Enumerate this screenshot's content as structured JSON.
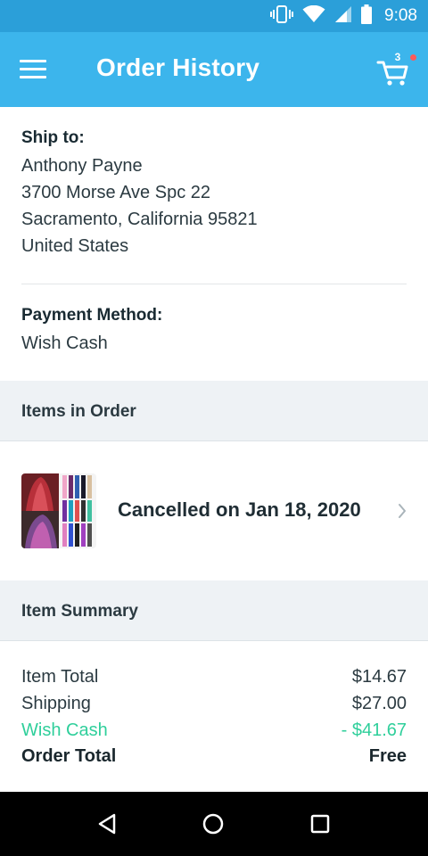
{
  "status_bar": {
    "time": "9:08"
  },
  "app_bar": {
    "title": "Order History",
    "cart_count": "3"
  },
  "shipping": {
    "label": "Ship to:",
    "name": "Anthony Payne",
    "street": "3700 Morse Ave Spc 22",
    "city_state_zip": "Sacramento, California 95821",
    "country": "United States"
  },
  "payment": {
    "label": "Payment Method:",
    "method": "Wish Cash"
  },
  "items_section": {
    "header": "Items in Order",
    "items": [
      {
        "status": "Cancelled on Jan 18, 2020"
      }
    ]
  },
  "summary": {
    "header": "Item Summary",
    "rows": [
      {
        "label": "Item Total",
        "value": "$14.67"
      },
      {
        "label": "Shipping",
        "value": "$27.00"
      },
      {
        "label": "Wish Cash",
        "value": "- $41.67"
      },
      {
        "label": "Order Total",
        "value": "Free"
      }
    ]
  },
  "colors": {
    "status_bar": "#2b9fd9",
    "app_bar": "#3cb5ec",
    "wish_cash_green": "#2fcf9b",
    "section_header_bg": "#eef2f5",
    "cart_badge_dot": "#ff5a5a"
  },
  "icons": {
    "menu": "hamburger-menu-icon",
    "cart": "shopping-cart-icon",
    "chevron": "chevron-right-icon",
    "nav_back": "triangle-back-icon",
    "nav_home": "circle-home-icon",
    "nav_recents": "square-recents-icon"
  }
}
